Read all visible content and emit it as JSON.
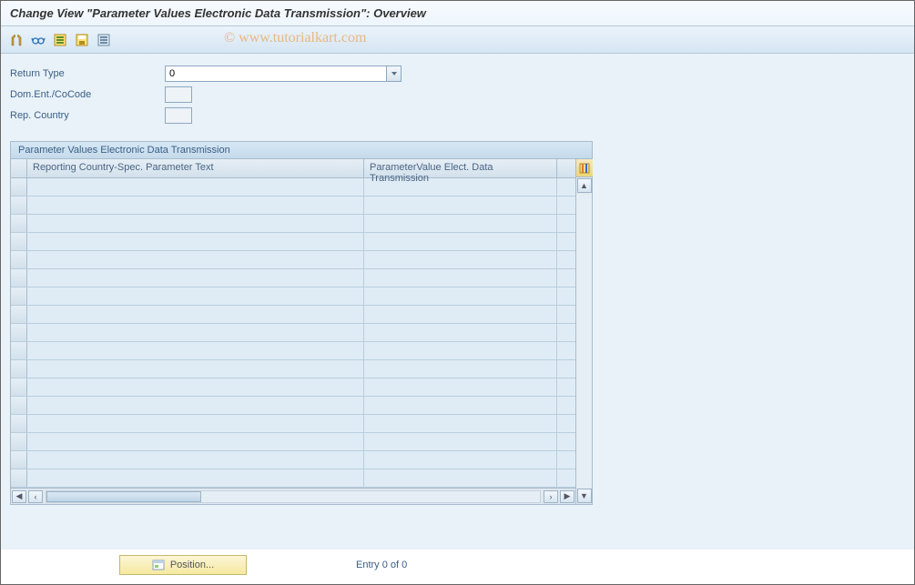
{
  "title": "Change View \"Parameter Values Electronic Data Transmission\": Overview",
  "watermark": "© www.tutorialkart.com",
  "toolbar": {
    "icons": [
      {
        "name": "toggle-display-change-icon"
      },
      {
        "name": "glasses-icon"
      },
      {
        "name": "select-all-icon"
      },
      {
        "name": "save-icon"
      },
      {
        "name": "deselect-all-icon"
      }
    ]
  },
  "form": {
    "return_type": {
      "label": "Return Type",
      "value": "0"
    },
    "dom_ent_cocode": {
      "label": "Dom.Ent./CoCode",
      "value": ""
    },
    "rep_country": {
      "label": "Rep. Country",
      "value": ""
    }
  },
  "panel": {
    "title": "Parameter Values Electronic Data Transmission",
    "columns": {
      "col1": "Reporting Country-Spec. Parameter Text",
      "col2": "ParameterValue Elect. Data Transmission"
    },
    "rows": [
      {},
      {},
      {},
      {},
      {},
      {},
      {},
      {},
      {},
      {},
      {},
      {},
      {},
      {},
      {},
      {},
      {}
    ]
  },
  "footer": {
    "position_button": "Position...",
    "entry_text": "Entry 0 of 0"
  }
}
